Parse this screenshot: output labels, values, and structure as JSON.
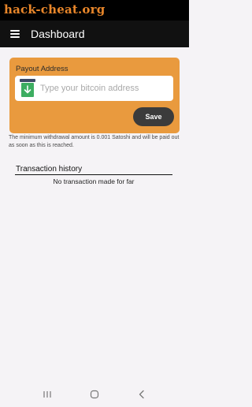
{
  "watermark": "hack-cheat.org",
  "app_bar": {
    "title": "Dashboard"
  },
  "payout": {
    "label": "Payout Address",
    "address_placeholder": "Type your bitcoin address",
    "address_value": "",
    "save_label": "Save",
    "note": "The minimum withdrawal amount is 0.001 Satoshi and will be paid out as soon as this is reached."
  },
  "history": {
    "title": "Transaction history",
    "empty_text": "No transaction made for far"
  },
  "colors": {
    "card": "#e99a3e",
    "save_button": "#3b3b3b",
    "wallet_green": "#3dad61",
    "app_bar": "#111111",
    "watermark": "#e8862a"
  },
  "icons": {
    "menu": "menu-icon",
    "wallet": "wallet-download-icon",
    "nav_recents": "recents-icon",
    "nav_home": "home-icon",
    "nav_back": "back-icon"
  }
}
